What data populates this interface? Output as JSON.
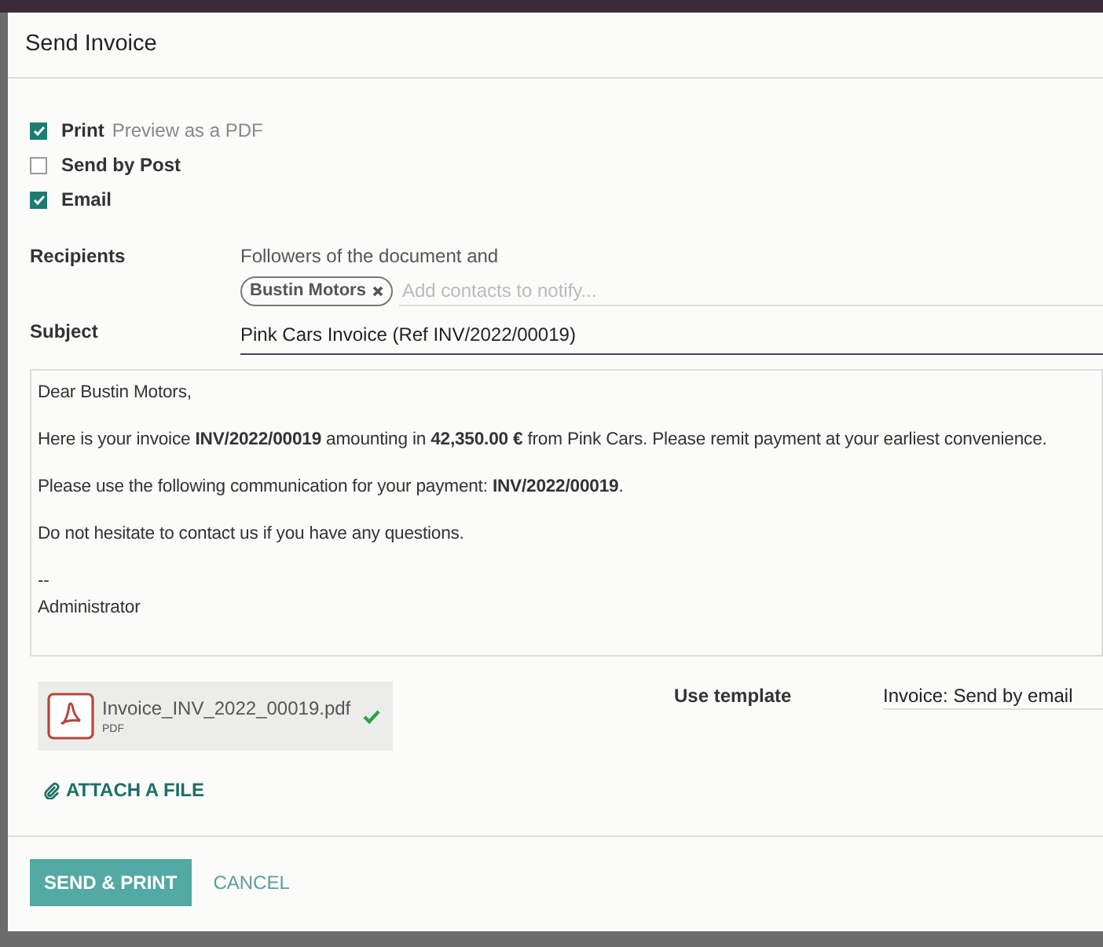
{
  "dialog": {
    "title": "Send Invoice"
  },
  "options": [
    {
      "label": "Print",
      "hint": "Preview as a PDF",
      "checked": true
    },
    {
      "label": "Send by Post",
      "checked": false
    },
    {
      "label": "Email",
      "checked": true
    }
  ],
  "recipients": {
    "label": "Recipients",
    "note": "Followers of the document and",
    "tags": [
      "Bustin Motors"
    ],
    "placeholder": "Add contacts to notify..."
  },
  "subject": {
    "label": "Subject",
    "value": "Pink Cars Invoice (Ref INV/2022/00019)"
  },
  "body": [
    "Dear Bustin Motors,",
    "Here is your invoice **INV/2022/00019** amounting in **42,350.00 €** from Pink Cars. Please remit payment at your earliest convenience.",
    "Please use the following communication for your payment: **INV/2022/00019**.",
    "Do not hesitate to contact us if you have any questions.",
    "--",
    "Administrator"
  ],
  "attachments": [
    {
      "filename": "Invoice_INV_2022_00019.pdf",
      "type": "PDF",
      "uploaded": true
    }
  ],
  "attach_link": "ATTACH A FILE",
  "template": {
    "label": "Use template",
    "value": "Invoice: Send by email"
  },
  "buttons": [
    {
      "label": "SEND & PRINT",
      "kind": "primary"
    },
    {
      "label": "CANCEL",
      "kind": "link"
    }
  ]
}
